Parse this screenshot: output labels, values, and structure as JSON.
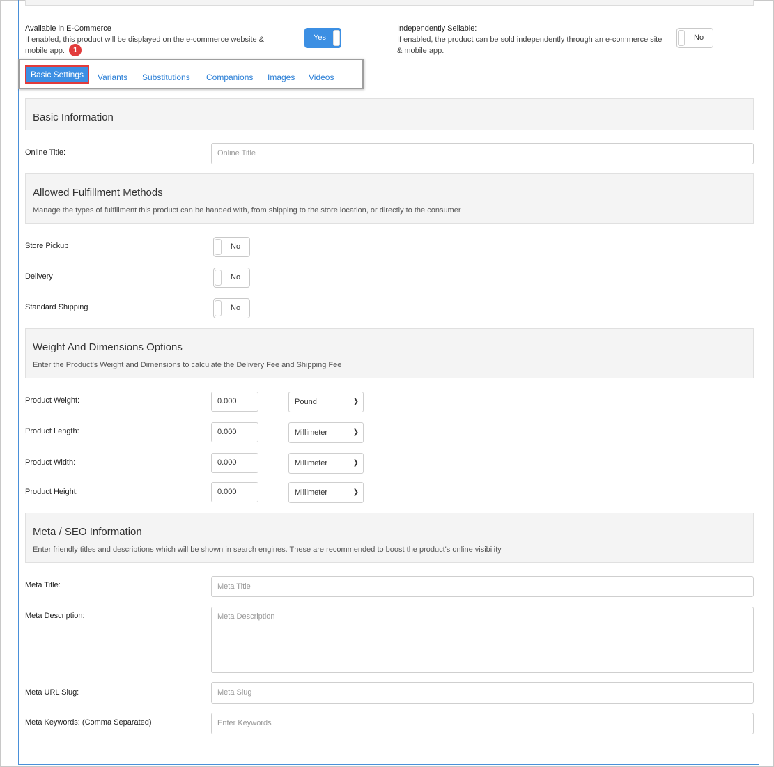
{
  "ecommerce": {
    "available_label": "Available in E-Commerce",
    "available_desc": "If enabled, this product will be displayed on the e-commerce website & mobile app.",
    "available_toggle": "Yes",
    "sellable_label": "Independently Sellable:",
    "sellable_desc": "If enabled, the product can be sold independently through an e-commerce site & mobile app.",
    "sellable_toggle": "No"
  },
  "tabs": [
    {
      "label": "Basic Settings",
      "active": true
    },
    {
      "label": "Variants"
    },
    {
      "label": "Substitutions"
    },
    {
      "label": "Companions"
    },
    {
      "label": "Images"
    },
    {
      "label": "Videos"
    }
  ],
  "annotation_badge": "1",
  "basic_info": {
    "title": "Basic Information",
    "online_title_label": "Online Title:",
    "online_title_placeholder": "Online Title"
  },
  "fulfillment": {
    "title": "Allowed Fulfillment Methods",
    "subtitle": "Manage the types of fulfillment this product can be handed with, from shipping to the store location, or directly to the consumer",
    "methods": [
      {
        "label": "Store Pickup",
        "toggle": "No"
      },
      {
        "label": "Delivery",
        "toggle": "No"
      },
      {
        "label": "Standard Shipping",
        "toggle": "No"
      }
    ]
  },
  "weight_dims": {
    "title": "Weight And Dimensions Options",
    "subtitle": "Enter the Product's Weight and Dimensions to calculate the Delivery Fee and Shipping Fee",
    "rows": [
      {
        "label": "Product Weight:",
        "value": "0.000",
        "unit": "Pound"
      },
      {
        "label": "Product Length:",
        "value": "0.000",
        "unit": "Millimeter"
      },
      {
        "label": "Product Width:",
        "value": "0.000",
        "unit": "Millimeter"
      },
      {
        "label": "Product Height:",
        "value": "0.000",
        "unit": "Millimeter"
      }
    ]
  },
  "meta": {
    "title": "Meta / SEO Information",
    "subtitle": "Enter friendly titles and descriptions which will be shown in search engines. These are recommended to boost the product's online visibility",
    "meta_title_label": "Meta Title:",
    "meta_title_placeholder": "Meta Title",
    "meta_desc_label": "Meta Description:",
    "meta_desc_placeholder": "Meta Description",
    "meta_slug_label": "Meta URL Slug:",
    "meta_slug_placeholder": "Meta Slug",
    "meta_keywords_label": "Meta Keywords: (Comma Separated)",
    "meta_keywords_placeholder": "Enter Keywords"
  },
  "colors": {
    "accent": "#3c8fe3",
    "link": "#2b7fd6",
    "highlight": "#e23b3b"
  }
}
